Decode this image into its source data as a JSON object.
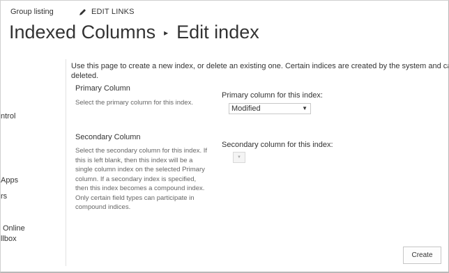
{
  "topnav": {
    "group_listing": "Group listing",
    "edit_links": "EDIT LINKS"
  },
  "page": {
    "title_part1": "Indexed Columns",
    "separator": "▸",
    "title_part2": "Edit index"
  },
  "leftnav": {
    "items": [
      "ntrol",
      "Apps",
      "rs",
      "Online",
      "llbox"
    ]
  },
  "description": "Use this page to create a new index, or delete an existing one. Certain indices are created by the system and ca deleted.",
  "primary": {
    "heading": "Primary Column",
    "text": "Select the primary column for this index.",
    "field_label": "Primary column for this index:",
    "selected_value": "Modified"
  },
  "secondary": {
    "heading": "Secondary Column",
    "text": "Select the secondary column for this index. If this is left blank, then this index will be a single column index on the selected Primary column. If a secondary index is specified, then this index becomes a compound index. Only certain field types can participate in compound indices.",
    "field_label": "Secondary column for this index:",
    "selected_value": ""
  },
  "actions": {
    "create_label": "Create"
  },
  "icons": {
    "edit": "pencil-icon",
    "dropdown": "chevron-down-icon"
  }
}
